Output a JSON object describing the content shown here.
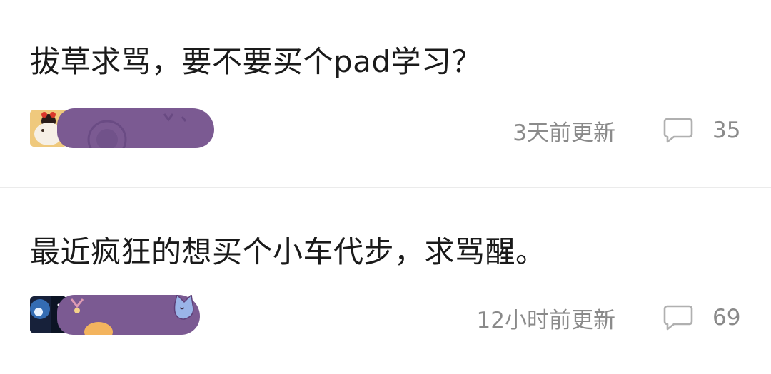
{
  "posts": [
    {
      "title": "拔草求骂，要不要买个pad学习？",
      "updated": "3天前更新",
      "comments": "35"
    },
    {
      "title": "最近疯狂的想买个小车代步，求骂醒。",
      "updated": "12小时前更新",
      "comments": "69"
    }
  ],
  "colors": {
    "title": "#1a1a1a",
    "meta": "#8a8a8a",
    "divider": "#ebebeb",
    "redaction": "#7b5a92"
  },
  "icons": {
    "comment": "speech-bubble-icon"
  }
}
